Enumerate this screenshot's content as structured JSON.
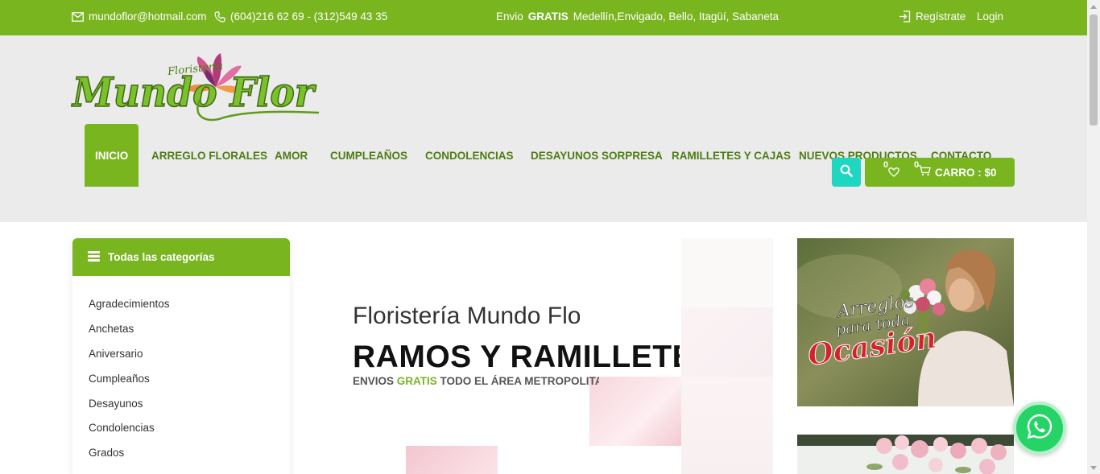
{
  "topbar": {
    "email": "mundoflor@hotmail.com",
    "phone": "(604)216 62 69 - (312)549 43 35",
    "shipping_prefix": "Envio",
    "shipping_bold": "GRATIS",
    "shipping_suffix": "Medellín,Envigado, Bello, Itagüí, Sabaneta",
    "register": "Regístrate",
    "login": "Login",
    "icons": [
      "envelope-icon",
      "phone-icon",
      "sign-in-icon"
    ]
  },
  "logo": {
    "small_text": "Floristería",
    "main_text": "Mundo Flor"
  },
  "nav": {
    "items": [
      {
        "label": "INICIO",
        "active": true
      },
      {
        "label": "ARREGLO FLORALES"
      },
      {
        "label": "AMOR"
      },
      {
        "label": "CUMPLEAÑOS"
      },
      {
        "label": "CONDOLENCIAS"
      },
      {
        "label": "DESAYUNOS SORPRESA"
      },
      {
        "label": "RAMILLETES Y CAJAS"
      },
      {
        "label": "NUEVOS PRODUCTOS"
      },
      {
        "label": "CONTACTO"
      }
    ]
  },
  "cart": {
    "wishlist_count": "0",
    "cart_count": "0",
    "label": "CARRO : $0"
  },
  "sidebar": {
    "title": "Todas las categorías",
    "categories": [
      "Agradecimientos",
      "Anchetas",
      "Aniversario",
      "Cumpleaños",
      "Desayunos",
      "Condolencias",
      "Grados"
    ]
  },
  "hero": {
    "subtitle": "Floristería Mundo Flor",
    "title": "RAMOS Y RAMILLETES",
    "shipping_prefix": "ENVIOS",
    "shipping_highlight": "GRATIS",
    "shipping_suffix": "TODO EL ÁREA METROPOLITANA"
  },
  "promo": {
    "line1": "Arreglos",
    "line2": "para toda",
    "line3": "Ocasión"
  },
  "colors": {
    "brand_green": "#78b51f",
    "nav_text": "#4e7d13",
    "search_teal": "#1fd6c0",
    "whatsapp": "#25d366"
  }
}
